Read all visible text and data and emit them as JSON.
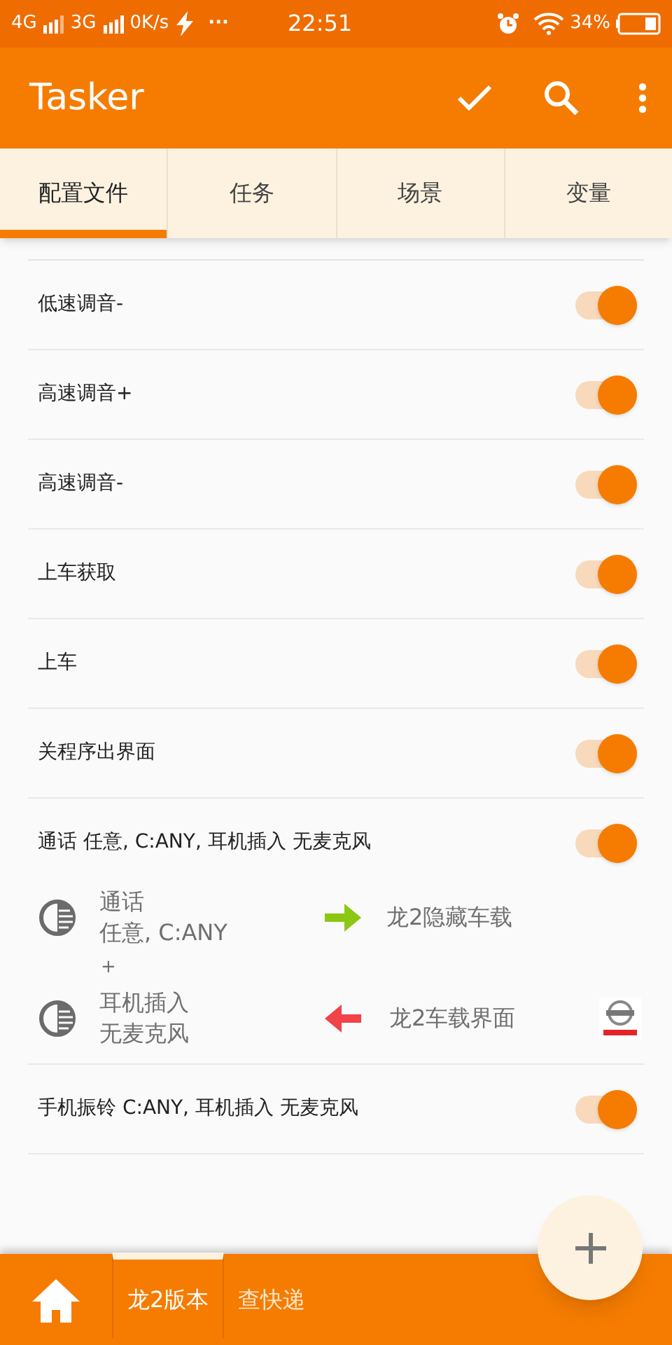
{
  "status_bar": {
    "networks": [
      "4G",
      "3G"
    ],
    "speed": "0K/s",
    "more": "···",
    "time": "22:51",
    "battery": "34%"
  },
  "app_bar": {
    "title": "Tasker"
  },
  "tabs": [
    {
      "label": "配置文件",
      "selected": true
    },
    {
      "label": "任务",
      "selected": false
    },
    {
      "label": "场景",
      "selected": false
    },
    {
      "label": "变量",
      "selected": false
    }
  ],
  "profiles": [
    {
      "name": "低速调音-",
      "on": true,
      "expanded": false
    },
    {
      "name": "高速调音+",
      "on": true,
      "expanded": false
    },
    {
      "name": "高速调音-",
      "on": true,
      "expanded": false
    },
    {
      "name": "上车获取",
      "on": true,
      "expanded": false
    },
    {
      "name": "上车",
      "on": true,
      "expanded": false
    },
    {
      "name": "关程序出界面",
      "on": true,
      "expanded": false
    },
    {
      "name": "通话 任意, C:ANY, 耳机插入 无麦克风",
      "on": true,
      "expanded": true,
      "contexts": [
        {
          "lines": [
            "通话",
            "任意, C:ANY"
          ]
        },
        {
          "lines": [
            "耳机插入",
            "无麦克风"
          ]
        }
      ],
      "joiner": "+",
      "tasks": [
        {
          "kind": "enter",
          "name": "龙2隐藏车载",
          "logo": false
        },
        {
          "kind": "exit",
          "name": "龙2车载界面",
          "logo": true
        }
      ]
    },
    {
      "name": "手机振铃 C:ANY, 耳机插入 无麦克风",
      "on": true,
      "expanded": false
    }
  ],
  "bottom_bar": {
    "projects": [
      {
        "label": "龙2版本",
        "selected": true
      },
      {
        "label": "查快递",
        "selected": false
      }
    ]
  }
}
